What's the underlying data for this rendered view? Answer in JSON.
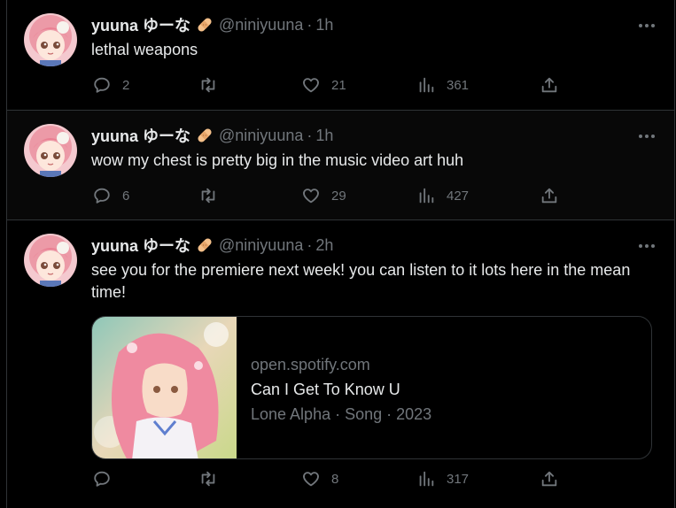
{
  "colors": {
    "background": "#000000",
    "text": "#e7e9ea",
    "secondary": "#71767b",
    "border": "#2f3336"
  },
  "tweets": [
    {
      "display_name": "yuuna ゆーな",
      "handle": "@niniyuuna",
      "separator": "·",
      "time": "1h",
      "text": "lethal weapons",
      "replies": "2",
      "retweets": "",
      "likes": "21",
      "views": "361"
    },
    {
      "display_name": "yuuna ゆーな",
      "handle": "@niniyuuna",
      "separator": "·",
      "time": "1h",
      "text": "wow my chest is pretty big in the music video art huh",
      "replies": "6",
      "retweets": "",
      "likes": "29",
      "views": "427"
    },
    {
      "display_name": "yuuna ゆーな",
      "handle": "@niniyuuna",
      "separator": "·",
      "time": "2h",
      "text": "see you for the premiere next week! you can listen to it lots here in the mean time!",
      "replies": "",
      "retweets": "",
      "likes": "8",
      "views": "317",
      "card": {
        "domain": "open.spotify.com",
        "title": "Can I Get To Know U",
        "meta": "Lone Alpha · Song · 2023"
      }
    }
  ],
  "icons": {
    "more": "more-horizontal-icon",
    "reply": "reply-icon",
    "retweet": "retweet-icon",
    "like": "heart-icon",
    "views": "views-chart-icon",
    "share": "share-icon",
    "bandage": "bandage-emoji-icon"
  }
}
